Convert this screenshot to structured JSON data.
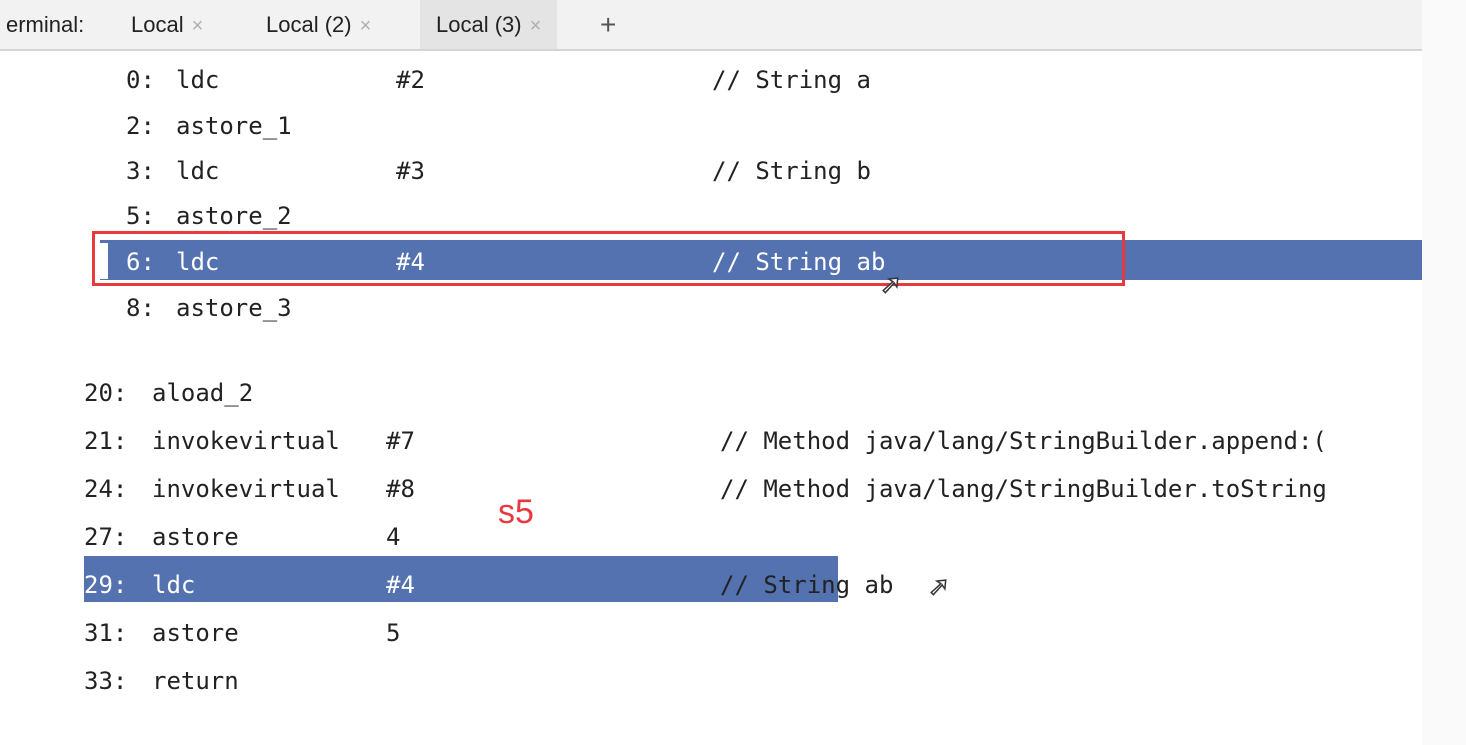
{
  "tabbar": {
    "label": "erminal:",
    "tabs": [
      {
        "label": "Local"
      },
      {
        "label": "Local (2)"
      },
      {
        "label": "Local (3)",
        "active": true
      }
    ],
    "close_glyph": "×",
    "add_glyph": "+"
  },
  "upper": [
    {
      "idx": "0:",
      "op": "ldc",
      "arg": "#2",
      "comment": "// String a"
    },
    {
      "idx": "2:",
      "op": "astore_1",
      "arg": "",
      "comment": ""
    },
    {
      "idx": "3:",
      "op": "ldc",
      "arg": "#3",
      "comment": "// String b"
    },
    {
      "idx": "5:",
      "op": "astore_2",
      "arg": "",
      "comment": ""
    },
    {
      "idx": "6:",
      "op": "ldc",
      "arg": "#4",
      "comment": "// String ab"
    },
    {
      "idx": "8:",
      "op": "astore_3",
      "arg": "",
      "comment": ""
    }
  ],
  "lower": [
    {
      "idx": "20:",
      "op": "aload_2",
      "arg": "",
      "comment": ""
    },
    {
      "idx": "21:",
      "op": "invokevirtual",
      "arg": "#7",
      "comment": "// Method java/lang/StringBuilder.append:("
    },
    {
      "idx": "24:",
      "op": "invokevirtual",
      "arg": "#8",
      "comment": "// Method java/lang/StringBuilder.toString"
    },
    {
      "idx": "27:",
      "op": "astore",
      "arg": "4",
      "comment": ""
    },
    {
      "idx": "29:",
      "op": "ldc",
      "arg": "#4",
      "comment": "// String ab"
    },
    {
      "idx": "31:",
      "op": "astore",
      "arg": "5",
      "comment": ""
    },
    {
      "idx": "33:",
      "op": "return",
      "arg": "",
      "comment": ""
    }
  ],
  "annotation": "s5",
  "colors": {
    "selection": "#5472b0",
    "annotation": "#e8393f"
  }
}
